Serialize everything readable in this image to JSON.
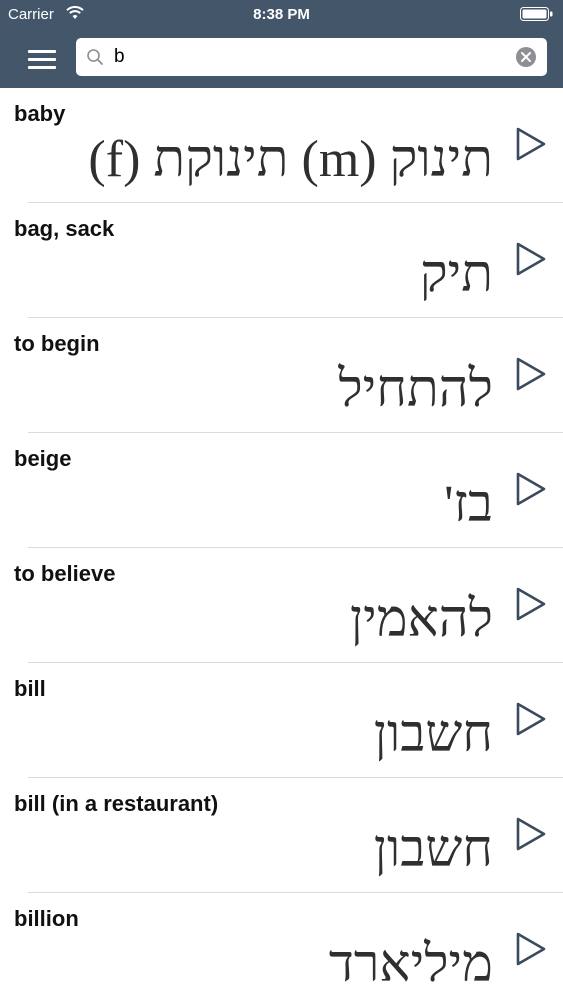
{
  "status_bar": {
    "carrier": "Carrier",
    "time": "8:38 PM"
  },
  "nav": {
    "menu_icon": "hamburger-menu-icon",
    "search": {
      "value": "b",
      "placeholder": "",
      "icon": "search-icon",
      "clear_icon": "clear-icon"
    }
  },
  "colors": {
    "nav_background": "#44566a",
    "text_primary": "#111111",
    "hebrew_text": "#2f2f2f",
    "play_icon": "#3b4b5d",
    "separator": "#dcdcdc"
  },
  "words": [
    {
      "english": "baby",
      "hebrew": "תינוק (m)  תינוקת (f)"
    },
    {
      "english": "bag, sack",
      "hebrew": "תיק"
    },
    {
      "english": "to begin",
      "hebrew": "להתחיל"
    },
    {
      "english": "beige",
      "hebrew": "בז'"
    },
    {
      "english": "to believe",
      "hebrew": "להאמין"
    },
    {
      "english": "bill",
      "hebrew": "חשבון"
    },
    {
      "english": "bill (in a restaurant)",
      "hebrew": "חשבון"
    },
    {
      "english": "billion",
      "hebrew": "מיליארד"
    }
  ]
}
